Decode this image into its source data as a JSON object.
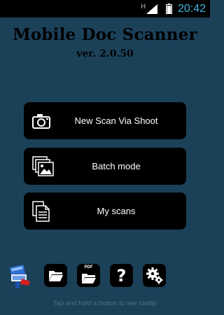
{
  "status_bar": {
    "network": "H",
    "time": "20:42"
  },
  "app": {
    "title": "Mobile Doc Scanner",
    "version": "ver. 2.0.50"
  },
  "menu": {
    "new_scan": "New Scan Via Shoot",
    "batch": "Batch mode",
    "my_scans": "My scans"
  },
  "toolbar": {
    "pdf_label": "PDF",
    "help_label": "?"
  },
  "hint": "Tap and hold a button to see tooltip",
  "colors": {
    "background": "#1b4159",
    "button": "#000000",
    "clock": "#3fb5e0"
  },
  "icons": [
    "camera-icon",
    "photos-stack-icon",
    "documents-icon",
    "app-logo-icon",
    "folder-open-icon",
    "pdf-folder-icon",
    "help-icon",
    "settings-icon"
  ]
}
